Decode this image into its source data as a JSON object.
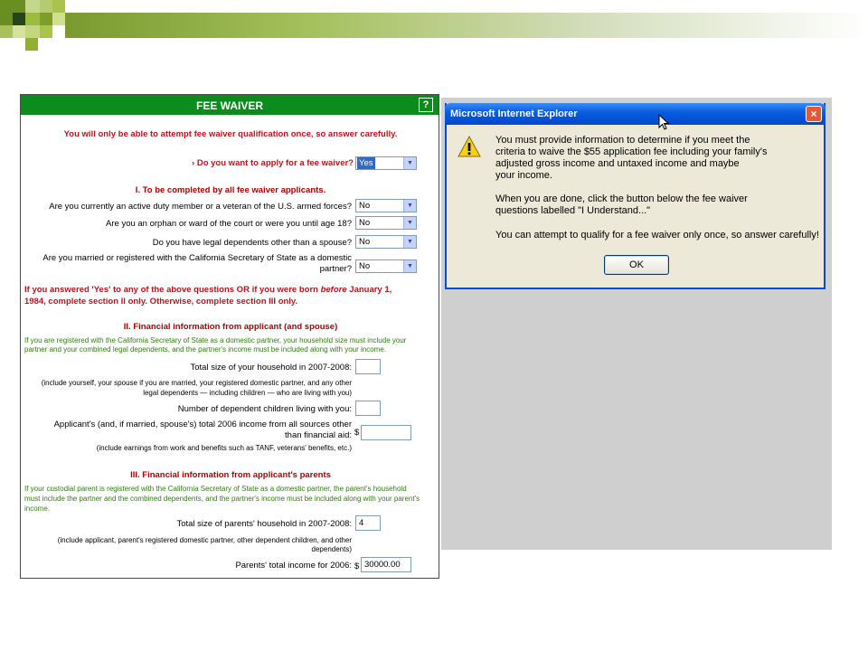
{
  "colors": {
    "form_header_bg": "#0d8c1e",
    "warning_red": "#c1121c",
    "section_heading": "#b00000",
    "info_green": "#2e7d0e",
    "dialog_title_blue": "#0a5fe0",
    "dialog_bg": "#ece9d8",
    "backdrop_gray": "#cfcfcf"
  },
  "form": {
    "title": "FEE WAIVER",
    "help_icon": "?",
    "warning": "You will only be able to attempt fee waiver qualification once, so answer carefully.",
    "apply_marker": "›",
    "apply_question": "Do you want to apply for a fee waiver?",
    "apply_value": "Yes",
    "section1": {
      "heading": "I. To be completed by all fee waiver applicants.",
      "questions": [
        {
          "label": "Are you currently an active duty member or a veteran of the U.S. armed forces?",
          "value": "No"
        },
        {
          "label": "Are you an orphan or ward of the court or were you until age 18?",
          "value": "No"
        },
        {
          "label": "Do you have legal dependents other than a spouse?",
          "value": "No"
        },
        {
          "label_line1": "Are you married or registered with the California Secretary of State as a domestic",
          "label_line2": "partner?",
          "value": "No"
        }
      ]
    },
    "instruction": {
      "part1": "If you answered 'Yes' to any of the above questions OR if you were born ",
      "emph": "before",
      "part2": " January 1,",
      "line2": "1984, complete section II only. Otherwise, complete section III only."
    },
    "section2": {
      "heading": "II. Financial information from applicant (and spouse)",
      "info_line1": "If you are registered with the California Secretary of State as a domestic partner, your household size must include your",
      "info_line2": "partner and your combined legal dependents, and the partner's income must be included along with your income.",
      "household_label": "Total size of your household in 2007-2008:",
      "household_value": "",
      "household_note1": "(include yourself, your spouse if you are married, your registered domestic partner, and any other",
      "household_note2": "legal dependents — including children — who are living with you)",
      "children_label": "Number of dependent children living with you:",
      "children_value": "",
      "income_label1": "Applicant's (and, if married, spouse's) total 2006 income from all sources other",
      "income_label2": "than financial aid:",
      "income_currency": "$",
      "income_value": "",
      "income_note": "(include earnings from work and benefits such as TANF, veterans' benefits, etc.)"
    },
    "section3": {
      "heading": "III. Financial information from applicant's parents",
      "info_line1": "If your custodial parent is registered with the California Secretary of State as a domestic partner, the parent's household",
      "info_line2": "must include the partner and the combined dependents, and the partner's income must be included along with your parent's",
      "info_line3": "income.",
      "household_label": "Total size of parents' household in 2007-2008:",
      "household_value": "4",
      "household_note1": "(include applicant, parent's registered domestic partner, other dependent children, and other",
      "household_note2": "dependents)",
      "income_label": "Parents' total income for 2006:",
      "income_currency": "$",
      "income_value": "30000.00"
    }
  },
  "dialog": {
    "title": "Microsoft Internet Explorer",
    "close_icon": "×",
    "icon": "warning-icon",
    "message_lines": [
      "You must provide information to determine if you meet the",
      "criteria to waive the $55 application fee including your family's",
      "adjusted gross income and untaxed income and maybe",
      "your income.",
      "When you are done, click the button below the fee waiver",
      "questions labelled \"I Understand...\"",
      "You can attempt to qualify for a fee waiver only once, so answer carefully!"
    ],
    "ok_label": "OK"
  }
}
